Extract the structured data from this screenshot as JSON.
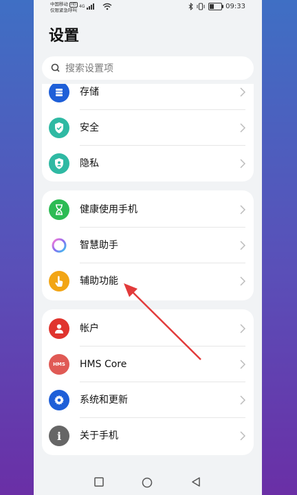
{
  "status_bar": {
    "carrier_line1": "中国移动",
    "hd_badge": "HD",
    "carrier_line2": "仅限紧急呼叫",
    "signal_label": "4G",
    "time": "09:33",
    "battery_level": 0.35
  },
  "page": {
    "title": "设置"
  },
  "search": {
    "placeholder": "搜索设置项"
  },
  "groups": [
    {
      "items": [
        {
          "label": "存储",
          "icon": "storage-icon",
          "color": "#1e5fd8"
        },
        {
          "label": "安全",
          "icon": "shield-check-icon",
          "color": "#2fb9a3"
        },
        {
          "label": "隐私",
          "icon": "privacy-shield-icon",
          "color": "#2fb9a3"
        }
      ]
    },
    {
      "items": [
        {
          "label": "健康使用手机",
          "icon": "hourglass-icon",
          "color": "#2dbb54"
        },
        {
          "label": "智慧助手",
          "icon": "assistant-ring-icon",
          "color": "#8a6cf0"
        },
        {
          "label": "辅助功能",
          "icon": "hand-tap-icon",
          "color": "#f2a515"
        }
      ]
    },
    {
      "items": [
        {
          "label": "帐户",
          "icon": "user-icon",
          "color": "#e0342e"
        },
        {
          "label": "HMS Core",
          "icon": "hms-icon",
          "icon_text": "HMS",
          "color": "#e05a55"
        },
        {
          "label": "系统和更新",
          "icon": "gear-icon",
          "color": "#1e5fd8"
        },
        {
          "label": "关于手机",
          "icon": "info-icon",
          "icon_text": "i",
          "color": "#666666"
        }
      ]
    }
  ],
  "nav": {
    "recent": "recent-apps-icon",
    "home": "home-icon",
    "back": "back-icon"
  },
  "annotation": {
    "color": "#e23b3b"
  }
}
